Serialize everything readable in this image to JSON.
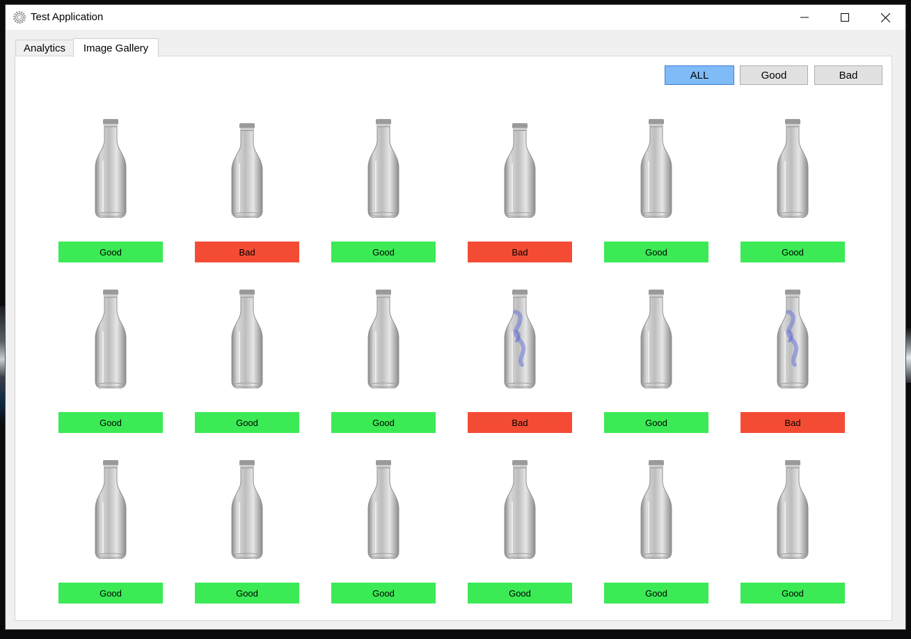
{
  "window": {
    "title": "Test Application",
    "icon": "gear-icon"
  },
  "window_controls": [
    "minimize-icon",
    "maximize-icon",
    "close-icon"
  ],
  "tabs": [
    {
      "label": "Analytics",
      "active": false
    },
    {
      "label": "Image Gallery",
      "active": true
    }
  ],
  "filters": {
    "all": "ALL",
    "good": "Good",
    "bad": "Bad",
    "selected": "ALL",
    "selected_color": "#7fbbf7"
  },
  "colors": {
    "good": "#3bea55",
    "bad": "#f44c34"
  },
  "gallery": {
    "items": [
      {
        "status": "Good",
        "defect": false
      },
      {
        "status": "Bad",
        "defect": false
      },
      {
        "status": "Good",
        "defect": false
      },
      {
        "status": "Bad",
        "defect": false
      },
      {
        "status": "Good",
        "defect": false
      },
      {
        "status": "Good",
        "defect": false
      },
      {
        "status": "Good",
        "defect": false
      },
      {
        "status": "Good",
        "defect": false
      },
      {
        "status": "Good",
        "defect": false
      },
      {
        "status": "Bad",
        "defect": true
      },
      {
        "status": "Good",
        "defect": false
      },
      {
        "status": "Bad",
        "defect": true
      },
      {
        "status": "Good",
        "defect": false
      },
      {
        "status": "Good",
        "defect": false
      },
      {
        "status": "Good",
        "defect": false
      },
      {
        "status": "Good",
        "defect": false
      },
      {
        "status": "Good",
        "defect": false
      },
      {
        "status": "Good",
        "defect": false
      }
    ]
  }
}
